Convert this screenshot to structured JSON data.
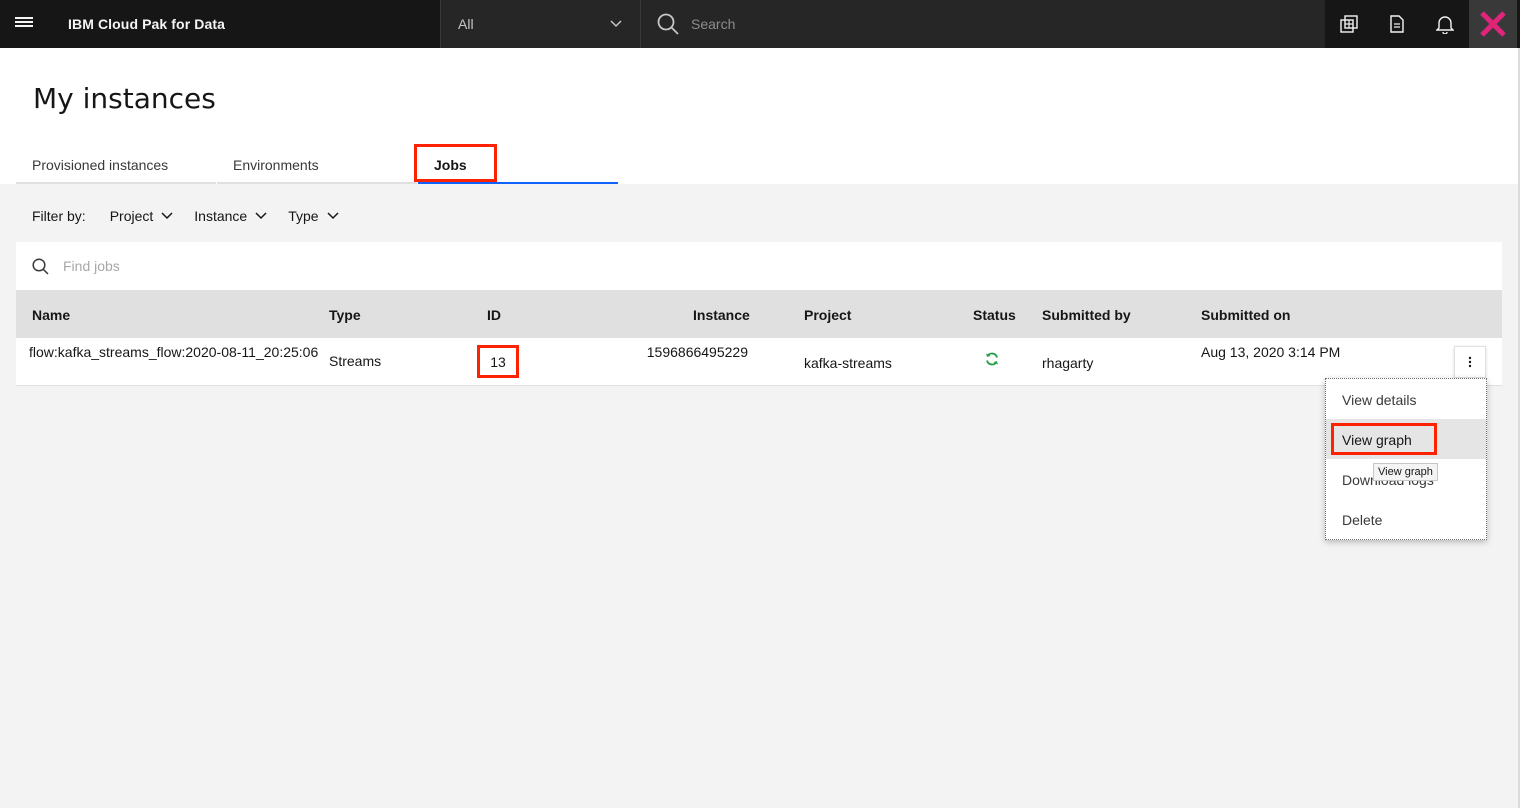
{
  "header": {
    "app_title": "IBM Cloud Pak for Data",
    "scope_value": "All",
    "search_placeholder": "Search",
    "icons": [
      "menu-icon",
      "catalog-icon",
      "document-icon",
      "notification-icon",
      "avatar"
    ]
  },
  "page": {
    "title": "My instances"
  },
  "tabs": [
    {
      "label": "Provisioned instances"
    },
    {
      "label": "Environments"
    },
    {
      "label": "Jobs",
      "active": true
    }
  ],
  "filters": {
    "label": "Filter by:",
    "dropdowns": [
      {
        "label": "Project"
      },
      {
        "label": "Instance"
      },
      {
        "label": "Type"
      }
    ]
  },
  "find": {
    "placeholder": "Find jobs"
  },
  "table": {
    "columns": [
      "Name",
      "Type",
      "ID",
      "Instance",
      "Project",
      "Status",
      "Submitted by",
      "Submitted on"
    ],
    "rows": [
      {
        "name": "flow:kafka_streams_flow:2020-08-11_20:25:06",
        "type": "Streams",
        "id": "13",
        "instance": "1596866495229",
        "project": "kafka-streams",
        "status": "running-icon",
        "submitted_by": "rhagarty",
        "submitted_on": "Aug 13, 2020 3:14 PM"
      }
    ]
  },
  "menu": {
    "items": [
      {
        "label": "View details"
      },
      {
        "label": "View graph"
      },
      {
        "label": "Download logs"
      },
      {
        "label": "Delete"
      }
    ],
    "tooltip": "View graph"
  },
  "colors": {
    "header_bg": "#161616",
    "accent": "#0f62fe",
    "highlight": "#ff2200",
    "status_green": "#24a148"
  }
}
